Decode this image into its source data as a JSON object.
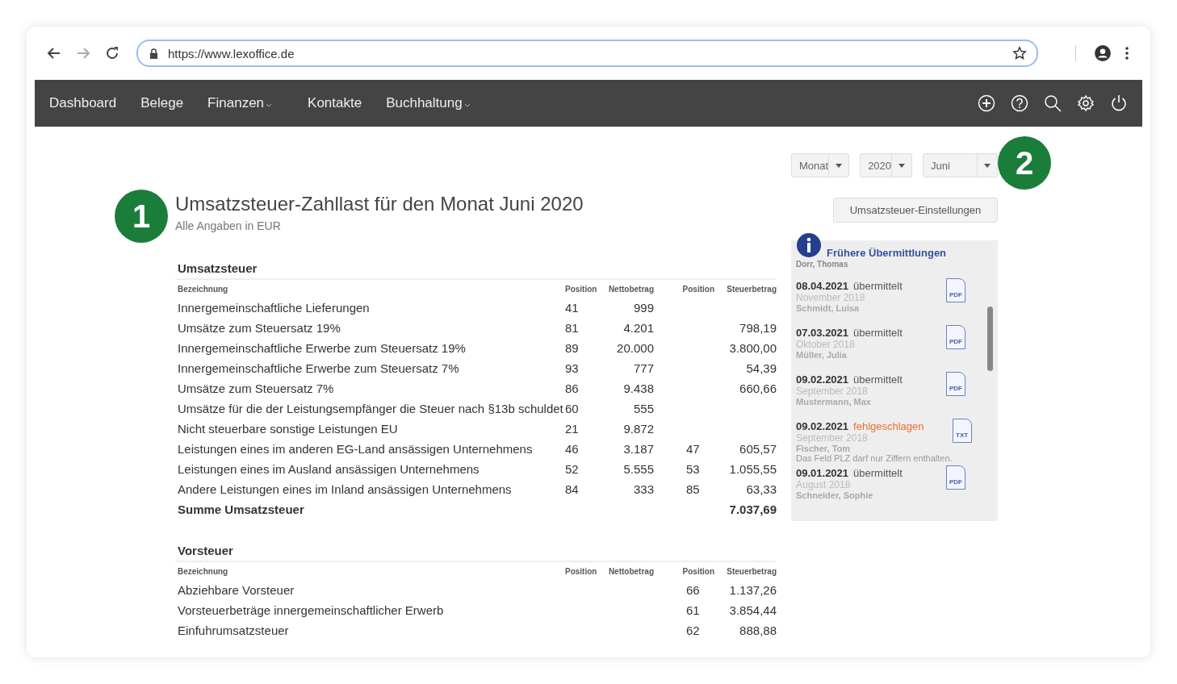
{
  "browser": {
    "url": "https://www.lexoffice.de"
  },
  "nav": {
    "items": [
      {
        "label": "Dashboard",
        "has_menu": false
      },
      {
        "label": "Belege",
        "has_menu": false
      },
      {
        "label": "Finanzen",
        "has_menu": true
      },
      {
        "label": "Kontakte",
        "has_menu": false
      },
      {
        "label": "Buchhaltung",
        "has_menu": true
      }
    ]
  },
  "markers": [
    "1",
    "2"
  ],
  "filters": [
    {
      "value": "Monat"
    },
    {
      "value": "2020"
    },
    {
      "value": "Juni"
    }
  ],
  "settings_button": "Umsatzsteuer-Einstellungen",
  "title": "Umsatzsteuer-Zahllast für den Monat Juni 2020",
  "subtitle": "Alle Angaben in EUR",
  "sections": [
    {
      "heading": "Umsatzsteuer",
      "columns": [
        "Bezeichnung",
        "Position",
        "Nettobetrag",
        "Position",
        "Steuerbetrag"
      ],
      "rows": [
        {
          "cells": [
            "Innergemeinschaftliche Lieferungen",
            "41",
            "999",
            "",
            ""
          ]
        },
        {
          "cells": [
            "Umsätze zum Steuersatz 19%",
            "81",
            "4.201",
            "",
            "798,19"
          ]
        },
        {
          "cells": [
            "Innergemeinschaftliche Erwerbe zum Steuersatz 19%",
            "89",
            "20.000",
            "",
            "3.800,00"
          ]
        },
        {
          "cells": [
            "Innergemeinschaftliche Erwerbe zum Steuersatz 7%",
            "93",
            "777",
            "",
            "54,39"
          ]
        },
        {
          "cells": [
            "Umsätze zum Steuersatz 7%",
            "86",
            "9.438",
            "",
            "660,66"
          ]
        },
        {
          "cells": [
            "Umsätze für die der Leistungsempfänger die Steuer nach §13b schuldet",
            "60",
            "555",
            "",
            ""
          ]
        },
        {
          "cells": [
            "Nicht steuerbare sonstige Leistungen EU",
            "21",
            "9.872",
            "",
            ""
          ]
        },
        {
          "cells": [
            "Leistungen eines im anderen EG-Land ansässigen Unternehmens",
            "46",
            "3.187",
            "47",
            "605,57"
          ]
        },
        {
          "cells": [
            "Leistungen eines im Ausland ansässigen Unternehmens",
            "52",
            "5.555",
            "53",
            "1.055,55"
          ]
        },
        {
          "cells": [
            "Andere Leistungen eines im Inland ansässigen Unternehmens",
            "84",
            "333",
            "85",
            "63,33"
          ]
        }
      ],
      "total": {
        "label": "Summe Umsatzsteuer",
        "value": "7.037,69"
      }
    },
    {
      "heading": "Vorsteuer",
      "columns": [
        "Bezeichnung",
        "Position",
        "Nettobetrag",
        "Position",
        "Steuerbetrag"
      ],
      "rows": [
        {
          "cells": [
            "Abziehbare Vorsteuer",
            "",
            "",
            "66",
            "1.137,26"
          ]
        },
        {
          "cells": [
            "Vorsteuerbeträge innergemeinschaftlicher Erwerb",
            "",
            "",
            "61",
            "3.854,44"
          ]
        },
        {
          "cells": [
            "Einfuhrumsatzsteuer",
            "",
            "",
            "62",
            "888,88"
          ]
        }
      ]
    }
  ],
  "submissions": {
    "title": "Frühere Übermittlungen",
    "cut_name": "Dorr, Thomas",
    "items": [
      {
        "date": "08.04.2021",
        "status": "übermittelt",
        "kind": "ok",
        "period": "November 2018",
        "name": "Schmidt, Luisa",
        "file": "PDF"
      },
      {
        "date": "07.03.2021",
        "status": "übermittelt",
        "kind": "ok",
        "period": "Oktober 2018",
        "name": "Müller, Julia",
        "file": "PDF"
      },
      {
        "date": "09.02.2021",
        "status": "übermittelt",
        "kind": "ok",
        "period": "September 2018",
        "name": "Mustermann, Max",
        "file": "PDF"
      },
      {
        "date": "09.02.2021",
        "status": "fehlgeschlagen",
        "kind": "failed",
        "period": "September 2018",
        "name": "Fischer, Tom",
        "file": "TXT",
        "error": "Das Feld PLZ darf nur Ziffern enthalten."
      },
      {
        "date": "09.01.2021",
        "status": "übermittelt",
        "kind": "ok",
        "period": "August 2018",
        "name": "Schneider, Sophie",
        "file": "PDF"
      }
    ]
  }
}
